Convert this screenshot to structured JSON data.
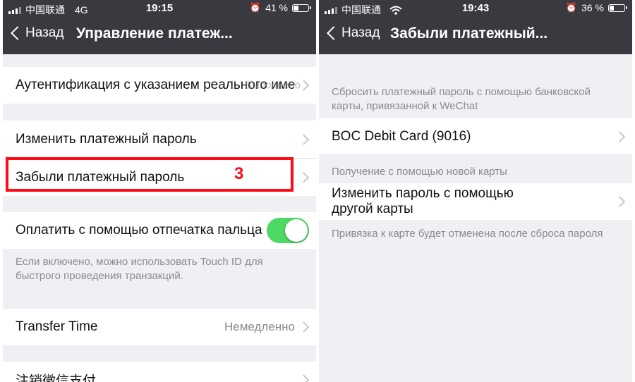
{
  "left": {
    "status": {
      "carrier": "中国联通",
      "network": "4G",
      "time": "19:15",
      "battery": "41 %",
      "battery_level": 0.41
    },
    "nav": {
      "back_label": "Назад",
      "title": "Управление платеж..."
    },
    "rows": {
      "auth_label": "Аутентификация с указанием реального име",
      "auth_overlay": "Выполнено",
      "change_pwd": "Изменить платежный пароль",
      "forgot_pwd": "Забыли платежный пароль",
      "fingerprint": "Оплатить с помощью отпечатка пальца",
      "fingerprint_note": "Если включено, можно использовать Touch ID для быстрого проведения транзакций.",
      "transfer_time": "Transfer Time",
      "transfer_value": "Немедленно",
      "cancel_wechat_pay": "注销微信支付"
    },
    "fingerprint_enabled": true,
    "annotation": "3"
  },
  "right": {
    "status": {
      "carrier": "中国联通",
      "time": "19:43",
      "battery": "36 %",
      "battery_level": 0.36
    },
    "nav": {
      "back_label": "Назад",
      "title": "Забыли платежный..."
    },
    "section1_note": "Сбросить платежный пароль с помощью банковской карты, привязанной к WeChat",
    "card_label": "BOC Debit Card (9016)",
    "section2_note": "Получение с помощью новой карты",
    "other_card_line1": "Изменить пароль с помощью",
    "other_card_line2": "другой карты",
    "footer_note": "Привязка к карте будет отменена после сброса пароля"
  },
  "colors": {
    "header": "#393a3f",
    "toggle_on": "#4cd964",
    "highlight": "#ff0b17",
    "background": "#efeff4"
  }
}
